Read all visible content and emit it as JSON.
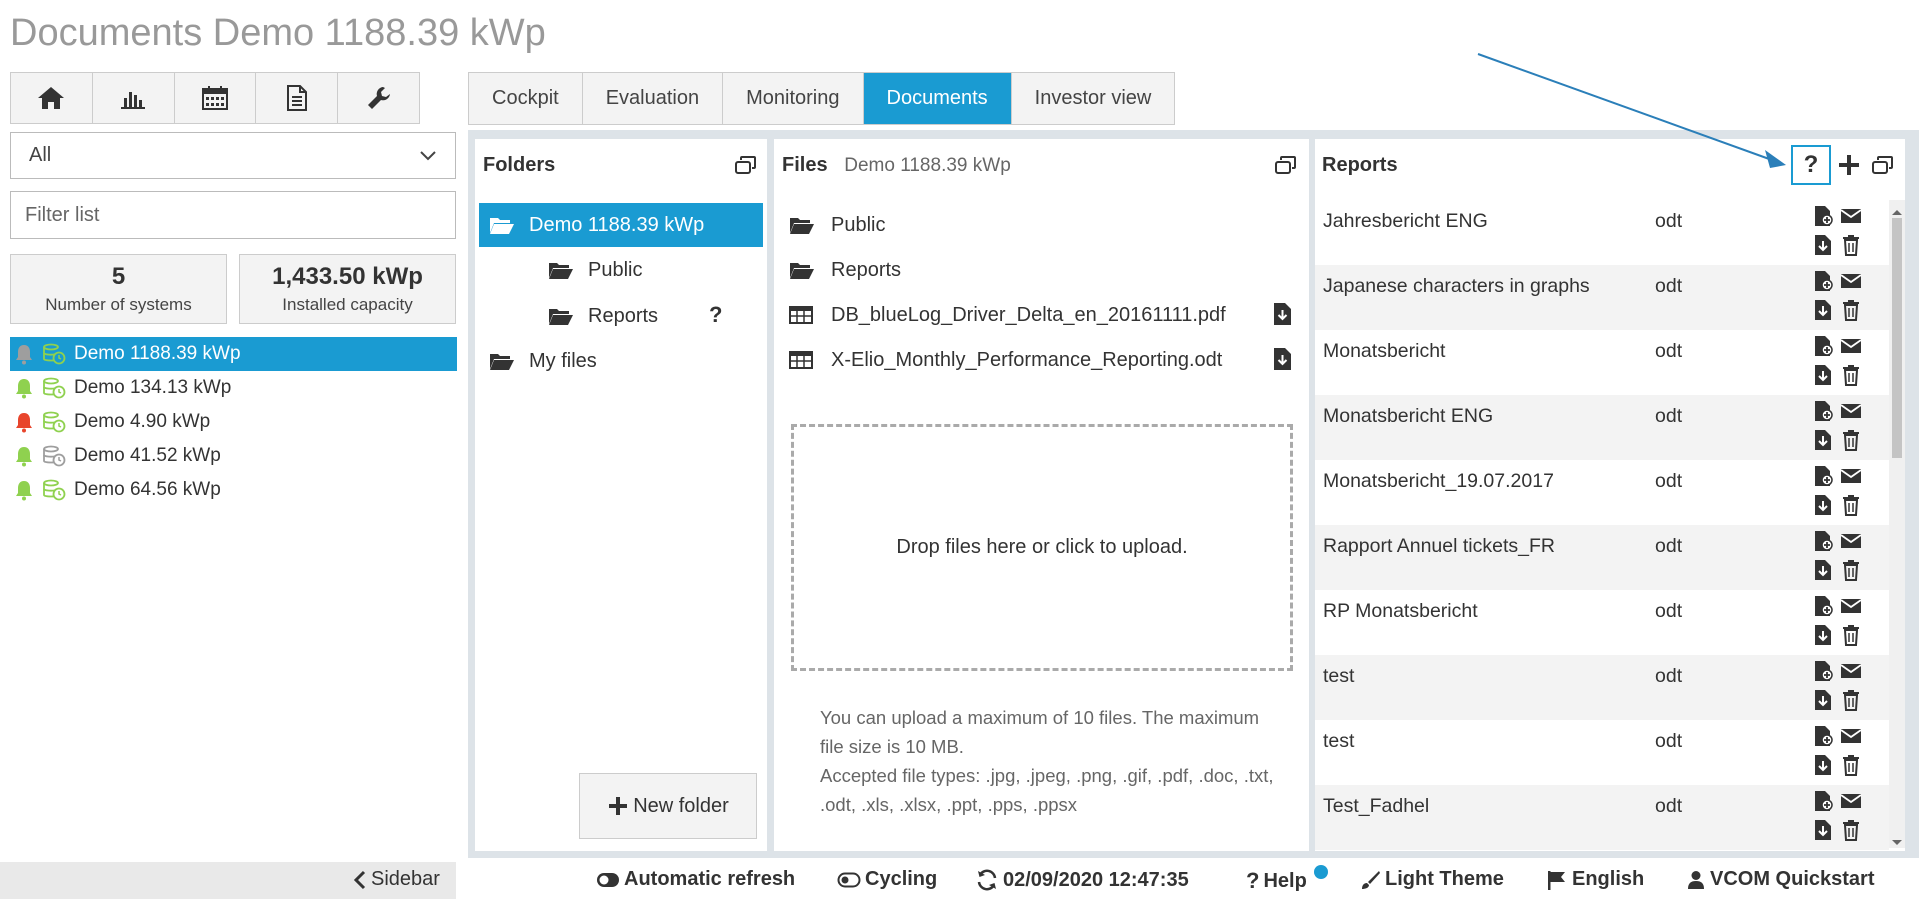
{
  "page": {
    "title": "Documents Demo 1188.39 kWp"
  },
  "sidebar": {
    "select_value": "All",
    "filter_placeholder": "Filter list",
    "stats": [
      {
        "value": "5",
        "label": "Number of systems"
      },
      {
        "value": "1,433.50 kWp",
        "label": "Installed capacity"
      }
    ],
    "systems": [
      {
        "name": "Demo 1188.39 kWp",
        "alarm": "grey",
        "active": true
      },
      {
        "name": "Demo 134.13 kWp",
        "alarm": "green"
      },
      {
        "name": "Demo 4.90 kWp",
        "alarm": "red"
      },
      {
        "name": "Demo 41.52 kWp",
        "alarm": "green"
      },
      {
        "name": "Demo 64.56 kWp",
        "alarm": "green"
      }
    ],
    "toggle_label": "Sidebar"
  },
  "tabs": [
    "Cockpit",
    "Evaluation",
    "Monitoring",
    "Documents",
    "Investor view"
  ],
  "folders": {
    "title": "Folders",
    "items": [
      {
        "label": "Demo 1188.39 kWp"
      },
      {
        "label": "Public"
      },
      {
        "label": "Reports"
      },
      {
        "label": "My files"
      }
    ],
    "new_folder_label": "New folder"
  },
  "files": {
    "title": "Files",
    "subtitle": "Demo 1188.39 kWp",
    "items": [
      {
        "label": "Public",
        "type": "folder"
      },
      {
        "label": "Reports",
        "type": "folder"
      },
      {
        "label": "DB_blueLog_Driver_Delta_en_20161111.pdf",
        "type": "file"
      },
      {
        "label": "X-Elio_Monthly_Performance_Reporting.odt",
        "type": "file"
      }
    ],
    "dropzone_text": "Drop files here or click to upload.",
    "info_1": "You can upload a maximum of 10 files. The maximum file size is 10 MB.",
    "info_2": "Accepted file types: .jpg, .jpeg, .png, .gif, .pdf, .doc, .txt, .odt, .xls, .xlsx, .ppt, .pps, .ppsx"
  },
  "reports": {
    "title": "Reports",
    "items": [
      {
        "name": "Jahresbericht ENG",
        "ext": "odt"
      },
      {
        "name": "Japanese characters in graphs",
        "ext": "odt"
      },
      {
        "name": "Monatsbericht",
        "ext": "odt"
      },
      {
        "name": "Monatsbericht ENG",
        "ext": "odt"
      },
      {
        "name": "Monatsbericht_19.07.2017",
        "ext": "odt"
      },
      {
        "name": "Rapport Annuel tickets_FR",
        "ext": "odt"
      },
      {
        "name": "RP Monatsbericht",
        "ext": "odt"
      },
      {
        "name": "test",
        "ext": "odt"
      },
      {
        "name": "test",
        "ext": "odt"
      },
      {
        "name": "Test_Fadhel",
        "ext": "odt"
      }
    ]
  },
  "bottom_bar": {
    "auto_refresh": "Automatic refresh",
    "cycling": "Cycling",
    "timestamp": "02/09/2020 12:47:35",
    "help": "Help",
    "theme": "Light Theme",
    "language": "English",
    "quickstart": "VCOM Quickstart"
  },
  "colors": {
    "accent": "#1a9bd2",
    "alarm_green": "#8fd14f",
    "alarm_red": "#e8452c",
    "alarm_grey": "#9e9e9e"
  }
}
